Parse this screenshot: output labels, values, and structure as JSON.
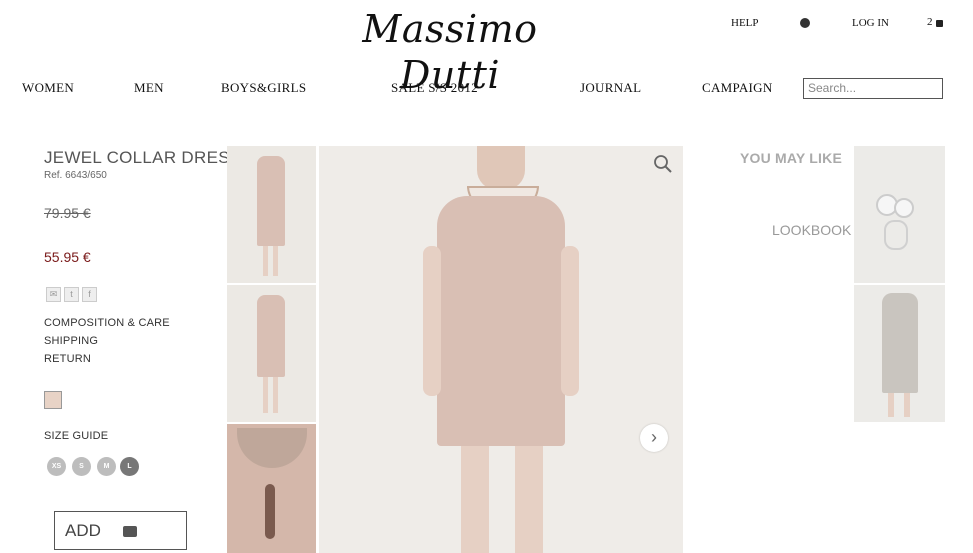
{
  "brand": {
    "logo_text": "Massimo Dutti"
  },
  "utility": {
    "help": "HELP",
    "login": "LOG IN",
    "cart_count": "2"
  },
  "nav": {
    "items": [
      "WOMEN",
      "MEN",
      "BOYS&GIRLS",
      "SALE S/S 2012",
      "JOURNAL",
      "CAMPAIGN"
    ],
    "search_placeholder": "Search..."
  },
  "product": {
    "title": "JEWEL COLLAR DRESS",
    "ref": "Ref. 6643/650",
    "old_price": "79.95 €",
    "new_price": "55.95 €",
    "links": [
      "COMPOSITION & CARE",
      "SHIPPING",
      "RETURN"
    ],
    "swatch_color": "#e8d3c6",
    "size_guide": "SIZE GUIDE",
    "sizes": [
      "XS",
      "S",
      "M",
      "L"
    ],
    "selected_size": "L",
    "add_label": "ADD"
  },
  "recommend": {
    "you_may_like": "YOU MAY LIKE",
    "lookbook": "LOOKBOOK"
  },
  "colors": {
    "price_sale": "#7a1a1a",
    "dress": "#d9bfb4",
    "bg_photo": "#efece8"
  },
  "icons": [
    "globe-icon",
    "cart-icon",
    "email-icon",
    "twitter-icon",
    "facebook-icon",
    "zoom-icon",
    "chevron-right-icon",
    "bag-icon"
  ]
}
